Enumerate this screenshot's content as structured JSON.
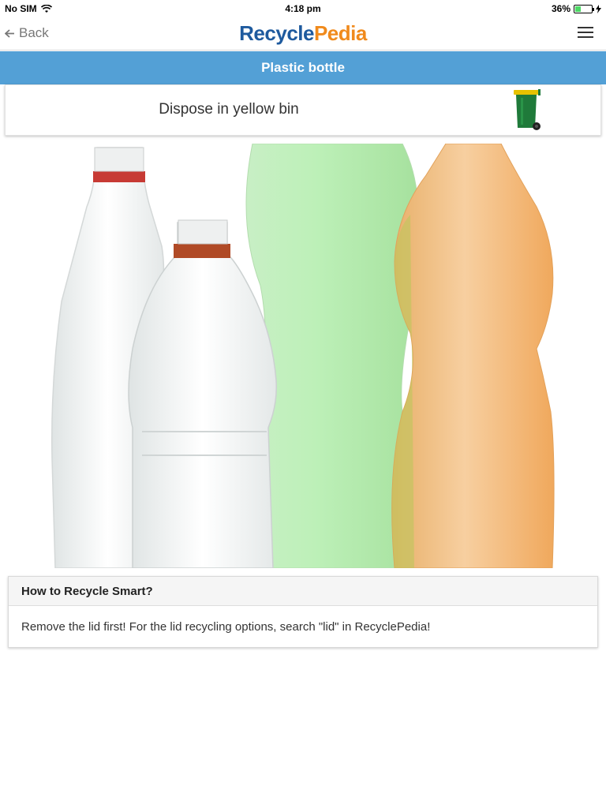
{
  "status_bar": {
    "carrier": "No SIM",
    "time": "4:18 pm",
    "battery_percent": "36%",
    "battery_level": 0.36
  },
  "nav": {
    "back_label": "Back",
    "logo_part1": "Recycle",
    "logo_part2": "Pedia",
    "menu_icon": "hamburger-menu-icon"
  },
  "item": {
    "title": "Plastic bottle",
    "disposal_text": "Dispose in yellow bin",
    "bin_icon": "wheelie-bin-icon"
  },
  "colors": {
    "header_blue": "#53a0d6",
    "logo_blue": "#1e5a9e",
    "logo_orange": "#f08a1c",
    "bin_green": "#1f7a3a",
    "bin_lid_yellow": "#e6c200"
  },
  "tip": {
    "heading": "How to Recycle Smart?",
    "body": "Remove the lid first! For the lid recycling options, search \"lid\" in RecyclePedia!"
  }
}
